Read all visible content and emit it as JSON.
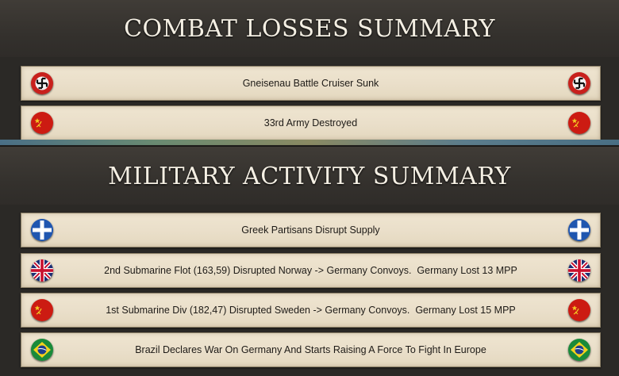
{
  "combat": {
    "title": "COMBAT LOSSES SUMMARY",
    "items": [
      {
        "text": "Gneisenau Battle Cruiser Sunk",
        "flag": "germany-flag-icon"
      },
      {
        "text": "33rd Army Destroyed",
        "flag": "ussr-flag-icon"
      }
    ]
  },
  "military": {
    "title": "MILITARY ACTIVITY SUMMARY",
    "items": [
      {
        "text": "Greek Partisans Disrupt Supply",
        "flag": "greece-flag-icon"
      },
      {
        "text": "2nd Submarine Flot (163,59) Disrupted Norway -> Germany Convoys.  Germany Lost 13 MPP",
        "flag": "uk-flag-icon"
      },
      {
        "text": "1st Submarine Div (182,47) Disrupted Sweden -> Germany Convoys.  Germany Lost 15 MPP",
        "flag": "ussr-flag-icon"
      },
      {
        "text": "Brazil Declares War On Germany And Starts Raising A Force To Fight In Europe",
        "flag": "brazil-flag-icon"
      }
    ]
  },
  "colors": {
    "header_bg": "#34312d",
    "row_bg": "#eadfca",
    "title_text": "#f4efe3",
    "germany_red": "#c8201c",
    "ussr_red": "#cc1b12",
    "greece_blue": "#1f56b0",
    "uk_blue": "#1d2f73",
    "brazil_green": "#1a8a3a"
  }
}
